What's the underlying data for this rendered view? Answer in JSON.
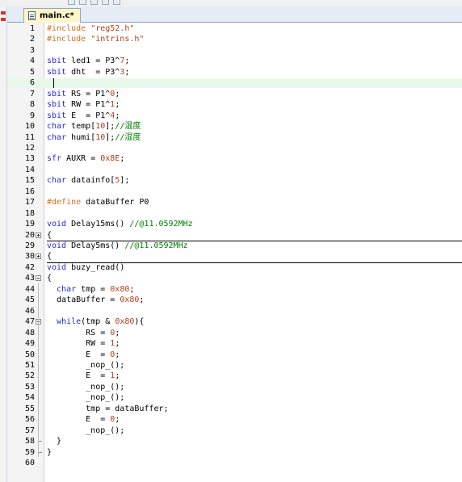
{
  "tab": {
    "filename": "main.c*"
  },
  "lines": [
    {
      "n": "1",
      "parts": [
        {
          "c": "pp",
          "t": "#include "
        },
        {
          "c": "s",
          "t": "\"reg52.h\""
        }
      ]
    },
    {
      "n": "2",
      "parts": [
        {
          "c": "pp",
          "t": "#include "
        },
        {
          "c": "s",
          "t": "\"intrins.h\""
        }
      ]
    },
    {
      "n": "3",
      "parts": []
    },
    {
      "n": "4",
      "parts": [
        {
          "c": "k",
          "t": "sbit "
        },
        {
          "c": "t",
          "t": "led1 = P3^"
        },
        {
          "c": "n",
          "t": "7"
        },
        {
          "c": "t",
          "t": ";"
        }
      ]
    },
    {
      "n": "5",
      "parts": [
        {
          "c": "k",
          "t": "sbit "
        },
        {
          "c": "t",
          "t": "dht  = P3^"
        },
        {
          "c": "n",
          "t": "3"
        },
        {
          "c": "t",
          "t": ";"
        }
      ]
    },
    {
      "n": "6",
      "current": true,
      "parts": []
    },
    {
      "n": "7",
      "parts": [
        {
          "c": "k",
          "t": "sbit "
        },
        {
          "c": "t",
          "t": "RS = P1^"
        },
        {
          "c": "n",
          "t": "0"
        },
        {
          "c": "t",
          "t": ";"
        }
      ]
    },
    {
      "n": "8",
      "parts": [
        {
          "c": "k",
          "t": "sbit "
        },
        {
          "c": "t",
          "t": "RW = P1^"
        },
        {
          "c": "n",
          "t": "1"
        },
        {
          "c": "t",
          "t": ";"
        }
      ]
    },
    {
      "n": "9",
      "parts": [
        {
          "c": "k",
          "t": "sbit "
        },
        {
          "c": "t",
          "t": "E  = P1^"
        },
        {
          "c": "n",
          "t": "4"
        },
        {
          "c": "t",
          "t": ";"
        }
      ]
    },
    {
      "n": "10",
      "parts": [
        {
          "c": "k",
          "t": "char "
        },
        {
          "c": "t",
          "t": "temp["
        },
        {
          "c": "n",
          "t": "10"
        },
        {
          "c": "t",
          "t": "];"
        },
        {
          "c": "c",
          "t": "//温度"
        }
      ]
    },
    {
      "n": "11",
      "parts": [
        {
          "c": "k",
          "t": "char "
        },
        {
          "c": "t",
          "t": "humi["
        },
        {
          "c": "n",
          "t": "10"
        },
        {
          "c": "t",
          "t": "];"
        },
        {
          "c": "c",
          "t": "//湿度"
        }
      ]
    },
    {
      "n": "12",
      "parts": []
    },
    {
      "n": "13",
      "parts": [
        {
          "c": "k",
          "t": "sfr "
        },
        {
          "c": "t",
          "t": "AUXR = "
        },
        {
          "c": "n",
          "t": "0x8E"
        },
        {
          "c": "t",
          "t": ";"
        }
      ]
    },
    {
      "n": "14",
      "parts": []
    },
    {
      "n": "15",
      "parts": [
        {
          "c": "k",
          "t": "char "
        },
        {
          "c": "t",
          "t": "datainfo["
        },
        {
          "c": "n",
          "t": "5"
        },
        {
          "c": "t",
          "t": "];"
        }
      ]
    },
    {
      "n": "16",
      "parts": []
    },
    {
      "n": "17",
      "parts": [
        {
          "c": "pp",
          "t": "#define "
        },
        {
          "c": "t",
          "t": "dataBuffer P0"
        }
      ]
    },
    {
      "n": "18",
      "parts": []
    },
    {
      "n": "19",
      "parts": [
        {
          "c": "k",
          "t": "void "
        },
        {
          "c": "t",
          "t": "Delay15ms() "
        },
        {
          "c": "c",
          "t": "//@11.0592MHz"
        }
      ]
    },
    {
      "n": "20",
      "fold": "plus",
      "sep": true,
      "parts": [
        {
          "c": "t",
          "t": "{"
        }
      ]
    },
    {
      "n": "29",
      "parts": [
        {
          "c": "k",
          "t": "void "
        },
        {
          "c": "t",
          "t": "Delay5ms() "
        },
        {
          "c": "c",
          "t": "//@11.0592MHz"
        }
      ]
    },
    {
      "n": "30",
      "fold": "plus",
      "sep": true,
      "parts": [
        {
          "c": "t",
          "t": "{"
        }
      ]
    },
    {
      "n": "42",
      "parts": [
        {
          "c": "k",
          "t": "void "
        },
        {
          "c": "t",
          "t": "buzy_read()"
        }
      ]
    },
    {
      "n": "43",
      "fold": "minus",
      "parts": [
        {
          "c": "t",
          "t": "{"
        }
      ]
    },
    {
      "n": "44",
      "parts": [
        {
          "c": "t",
          "t": "  "
        },
        {
          "c": "k",
          "t": "char "
        },
        {
          "c": "t",
          "t": "tmp = "
        },
        {
          "c": "n",
          "t": "0x80"
        },
        {
          "c": "t",
          "t": ";"
        }
      ]
    },
    {
      "n": "45",
      "parts": [
        {
          "c": "t",
          "t": "  dataBuffer = "
        },
        {
          "c": "n",
          "t": "0x80"
        },
        {
          "c": "t",
          "t": ";"
        }
      ]
    },
    {
      "n": "46",
      "parts": []
    },
    {
      "n": "47",
      "fold": "minus",
      "parts": [
        {
          "c": "t",
          "t": "  "
        },
        {
          "c": "k",
          "t": "while"
        },
        {
          "c": "t",
          "t": "(tmp & "
        },
        {
          "c": "n",
          "t": "0x80"
        },
        {
          "c": "t",
          "t": "){"
        }
      ]
    },
    {
      "n": "48",
      "parts": [
        {
          "c": "t",
          "t": "        RS = "
        },
        {
          "c": "n",
          "t": "0"
        },
        {
          "c": "t",
          "t": ";"
        }
      ]
    },
    {
      "n": "49",
      "parts": [
        {
          "c": "t",
          "t": "        RW = "
        },
        {
          "c": "n",
          "t": "1"
        },
        {
          "c": "t",
          "t": ";"
        }
      ]
    },
    {
      "n": "50",
      "parts": [
        {
          "c": "t",
          "t": "        E  = "
        },
        {
          "c": "n",
          "t": "0"
        },
        {
          "c": "t",
          "t": ";"
        }
      ]
    },
    {
      "n": "51",
      "parts": [
        {
          "c": "t",
          "t": "        _nop_();"
        }
      ]
    },
    {
      "n": "52",
      "parts": [
        {
          "c": "t",
          "t": "        E  = "
        },
        {
          "c": "n",
          "t": "1"
        },
        {
          "c": "t",
          "t": ";"
        }
      ]
    },
    {
      "n": "53",
      "parts": [
        {
          "c": "t",
          "t": "        _nop_();"
        }
      ]
    },
    {
      "n": "54",
      "parts": [
        {
          "c": "t",
          "t": "        _nop_();"
        }
      ]
    },
    {
      "n": "55",
      "parts": [
        {
          "c": "t",
          "t": "        tmp = dataBuffer;"
        }
      ]
    },
    {
      "n": "56",
      "parts": [
        {
          "c": "t",
          "t": "        E  = "
        },
        {
          "c": "n",
          "t": "0"
        },
        {
          "c": "t",
          "t": ";"
        }
      ]
    },
    {
      "n": "57",
      "parts": [
        {
          "c": "t",
          "t": "        _nop_();"
        }
      ]
    },
    {
      "n": "58",
      "end": true,
      "parts": [
        {
          "c": "t",
          "t": "  }"
        }
      ]
    },
    {
      "n": "59",
      "end": true,
      "parts": [
        {
          "c": "t",
          "t": "}"
        }
      ]
    },
    {
      "n": "60",
      "parts": []
    }
  ],
  "colors": {
    "keyword": "#2a2ad0",
    "number": "#b0401c",
    "comment": "#008000",
    "preprocessor": "#d07020",
    "current_line": "#e8f8ea"
  },
  "icons": [
    "file-icon",
    "fold-plus-icon",
    "fold-minus-icon"
  ]
}
